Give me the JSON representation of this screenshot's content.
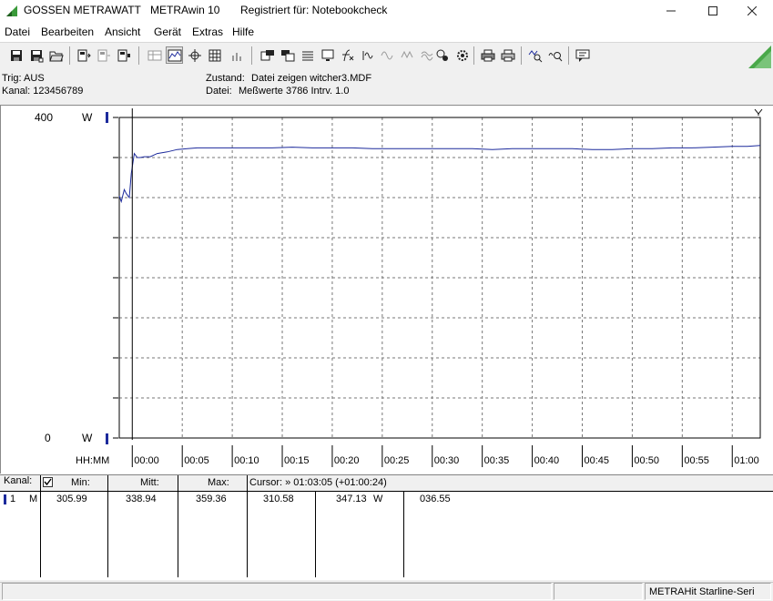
{
  "window": {
    "app_name": "GOSSEN METRAWATT",
    "product": "METRAwin 10",
    "registered": "Registriert für: Notebookcheck"
  },
  "menu": [
    "Datei",
    "Bearbeiten",
    "Ansicht",
    "Gerät",
    "Extras",
    "Hilfe"
  ],
  "info": {
    "trig": "Trig: AUS",
    "kanal": "Kanal: 123456789",
    "zustand_label": "Zustand:",
    "zustand_value": "Datei zeigen witcher3.MDF",
    "datei_label": "Datei:",
    "datei_value": "Meßwerte 3786  Intrv. 1.0"
  },
  "chart_data": {
    "type": "line",
    "ylabel_top": "400",
    "ylabel_bottom": "0",
    "unit_top": "W",
    "unit_bottom": "W",
    "ylim": [
      0,
      400
    ],
    "x_axis_label": "HH:MM",
    "x_ticks": [
      "00:00",
      "00:05",
      "00:10",
      "00:15",
      "00:20",
      "00:25",
      "00:30",
      "00:35",
      "00:40",
      "00:45",
      "00:50",
      "00:55",
      "01:00"
    ],
    "xlim_minutes": [
      -1.3,
      62.8
    ],
    "grid": true,
    "line_color": "#1c2a9c",
    "series": [
      {
        "x": [
          -1.3,
          -1.1,
          -0.8,
          -0.6,
          -0.3,
          -0.1,
          0.2,
          0.5,
          0.8,
          1.2,
          1.8,
          2.5,
          3.5,
          4.5,
          5.5,
          6.5,
          7.5,
          8.5,
          10,
          12,
          14,
          16,
          18,
          20,
          22,
          24,
          26,
          28,
          30,
          32,
          34,
          36,
          38,
          40,
          42,
          44,
          46,
          48,
          50,
          52,
          54,
          56,
          58,
          60,
          61.5,
          62.8
        ],
        "y": [
          302,
          295,
          310,
          305,
          300,
          330,
          355,
          350,
          350,
          351,
          351,
          355,
          357,
          360,
          361,
          362,
          362,
          362,
          362,
          362,
          362,
          363,
          362,
          362,
          362,
          361,
          361,
          361,
          361,
          361,
          361,
          360,
          361,
          361,
          361,
          361,
          360,
          360,
          361,
          361,
          362,
          362,
          363,
          364,
          364,
          365
        ]
      }
    ]
  },
  "table": {
    "headers": {
      "kanal": "Kanal:",
      "min": "Min:",
      "mitt": "Mitt:",
      "max": "Max:",
      "cursor": "Cursor: » 01:03:05 (+01:00:24)"
    },
    "row": {
      "channel_num": "1",
      "channel_mode": "M",
      "min": "305.99",
      "mitt": "338.94",
      "max": "359.36",
      "cursor1": "310.58",
      "cursor2": "347.13",
      "unit": "W",
      "cursor3": "036.55"
    }
  },
  "status": {
    "device": "METRAHit Starline-Seri"
  }
}
